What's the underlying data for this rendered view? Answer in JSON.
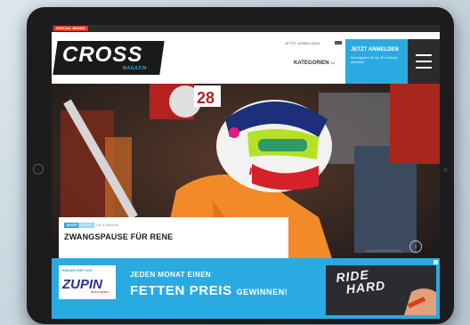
{
  "header": {
    "special_badge": "SPECIAL BRAND",
    "logo": "CROSS",
    "logo_sub": "MAGAZIN",
    "nav": {
      "kategorien": "KATEGORIEN"
    },
    "login_link": "JETZT ANMELDEN",
    "cta_title": "JETZT ANMELDEN",
    "cta_sub": "Dir Ausgaben für nur 4€ im Monat anmelden"
  },
  "hero": {
    "card": {
      "tag": "MXGP",
      "tag2": "NEWS",
      "date": "Vor 3 Wochen",
      "title": "ZWANGSPAUSE FÜR RENE"
    },
    "slider_caption": "NÄCHSTER ARTIKEL"
  },
  "banner": {
    "zupin_small": "PRÄSENTIERT VON",
    "zupin_logo": "ZUPIN",
    "zupin_sub": "MOTO SPORT",
    "line1": "JEDEN MONAT EINEN",
    "line2a": "FETTEN PREIS",
    "line2b": "GEWINNEN!",
    "photo_text1": "RIDE",
    "photo_text2": "HARD"
  },
  "colors": {
    "accent": "#29abe2",
    "badge_red": "#e23a1e",
    "device": "#1c1c1e"
  },
  "icons": {
    "menu": "hamburger-menu-icon",
    "chevron": "chevron-down-icon",
    "next": "arrow-right-icon"
  }
}
